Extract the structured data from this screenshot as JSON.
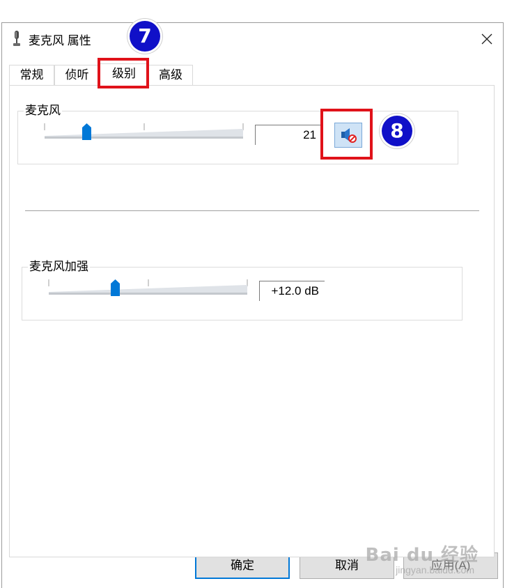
{
  "window": {
    "title": "麦克风 属性"
  },
  "tabs": [
    {
      "label": "常规"
    },
    {
      "label": "侦听"
    },
    {
      "label": "级别",
      "active": true
    },
    {
      "label": "高级"
    }
  ],
  "levels": {
    "microphone": {
      "label": "麦克风",
      "value": "21",
      "level": 21
    },
    "boost": {
      "label": "麦克风加强",
      "value": "+12.0 dB",
      "level": 0.33
    }
  },
  "buttons": {
    "ok": "确定",
    "cancel": "取消",
    "apply": "应用(A)"
  },
  "annotations": {
    "step7": "7",
    "step8": "8"
  },
  "watermark": {
    "logo": "Bai du 经验",
    "url": "jingyan.baidu.com"
  },
  "colors": {
    "accent": "#0078d7",
    "highlight": "#e0121a",
    "badge": "#1010c8"
  }
}
